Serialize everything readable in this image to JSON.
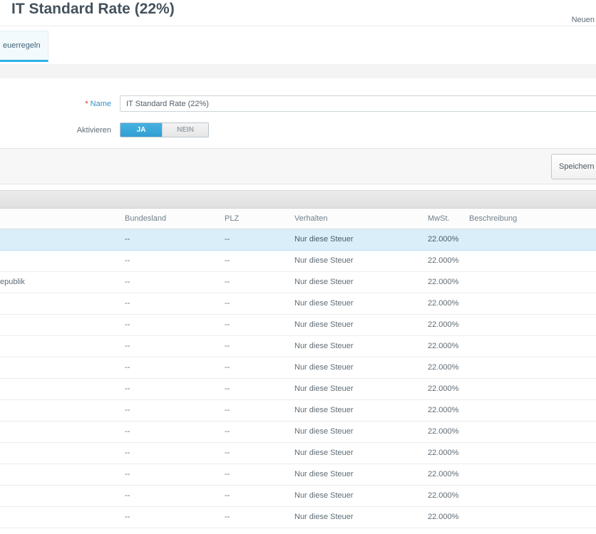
{
  "colors": {
    "accent": "#2db3e8",
    "toggle-active": "#2f9ed2",
    "toggle-active-light": "#47b2e2",
    "selection": "#daeefa"
  },
  "header": {
    "title": "IT Standard Rate (22%)",
    "new_button_label": "Neuen"
  },
  "tabs": {
    "steuerregeln": {
      "label": "euerregeln",
      "active": true
    }
  },
  "form": {
    "required_mark": "*",
    "name_label": "Name",
    "name_value": "IT Standard Rate (22%)",
    "aktivieren_label": "Aktivieren",
    "toggle_yes_label": "JA",
    "toggle_no_label": "NEIN"
  },
  "toolbar": {
    "save_label": "Speichern un"
  },
  "table": {
    "columns": {
      "bundesland": "Bundesland",
      "plz": "PLZ",
      "verhalten": "Verhalten",
      "mwst": "MwSt.",
      "beschreibung": "Beschreibung"
    },
    "rows": [
      {
        "selected": true,
        "country": "",
        "bundesland": "--",
        "plz": "--",
        "verhalten": "Nur diese Steuer",
        "mwst": "22.000%",
        "beschreibung": ""
      },
      {
        "selected": false,
        "country": "",
        "bundesland": "--",
        "plz": "--",
        "verhalten": "Nur diese Steuer",
        "mwst": "22.000%",
        "beschreibung": ""
      },
      {
        "selected": false,
        "country": "epublik",
        "bundesland": "--",
        "plz": "--",
        "verhalten": "Nur diese Steuer",
        "mwst": "22.000%",
        "beschreibung": ""
      },
      {
        "selected": false,
        "country": "",
        "bundesland": "--",
        "plz": "--",
        "verhalten": "Nur diese Steuer",
        "mwst": "22.000%",
        "beschreibung": ""
      },
      {
        "selected": false,
        "country": "",
        "bundesland": "--",
        "plz": "--",
        "verhalten": "Nur diese Steuer",
        "mwst": "22.000%",
        "beschreibung": ""
      },
      {
        "selected": false,
        "country": "",
        "bundesland": "--",
        "plz": "--",
        "verhalten": "Nur diese Steuer",
        "mwst": "22.000%",
        "beschreibung": ""
      },
      {
        "selected": false,
        "country": "",
        "bundesland": "--",
        "plz": "--",
        "verhalten": "Nur diese Steuer",
        "mwst": "22.000%",
        "beschreibung": ""
      },
      {
        "selected": false,
        "country": "",
        "bundesland": "--",
        "plz": "--",
        "verhalten": "Nur diese Steuer",
        "mwst": "22.000%",
        "beschreibung": ""
      },
      {
        "selected": false,
        "country": "",
        "bundesland": "--",
        "plz": "--",
        "verhalten": "Nur diese Steuer",
        "mwst": "22.000%",
        "beschreibung": ""
      },
      {
        "selected": false,
        "country": "",
        "bundesland": "--",
        "plz": "--",
        "verhalten": "Nur diese Steuer",
        "mwst": "22.000%",
        "beschreibung": ""
      },
      {
        "selected": false,
        "country": "",
        "bundesland": "--",
        "plz": "--",
        "verhalten": "Nur diese Steuer",
        "mwst": "22.000%",
        "beschreibung": ""
      },
      {
        "selected": false,
        "country": "",
        "bundesland": "--",
        "plz": "--",
        "verhalten": "Nur diese Steuer",
        "mwst": "22.000%",
        "beschreibung": ""
      },
      {
        "selected": false,
        "country": "",
        "bundesland": "--",
        "plz": "--",
        "verhalten": "Nur diese Steuer",
        "mwst": "22.000%",
        "beschreibung": ""
      },
      {
        "selected": false,
        "country": "",
        "bundesland": "--",
        "plz": "--",
        "verhalten": "Nur diese Steuer",
        "mwst": "22.000%",
        "beschreibung": ""
      }
    ]
  }
}
